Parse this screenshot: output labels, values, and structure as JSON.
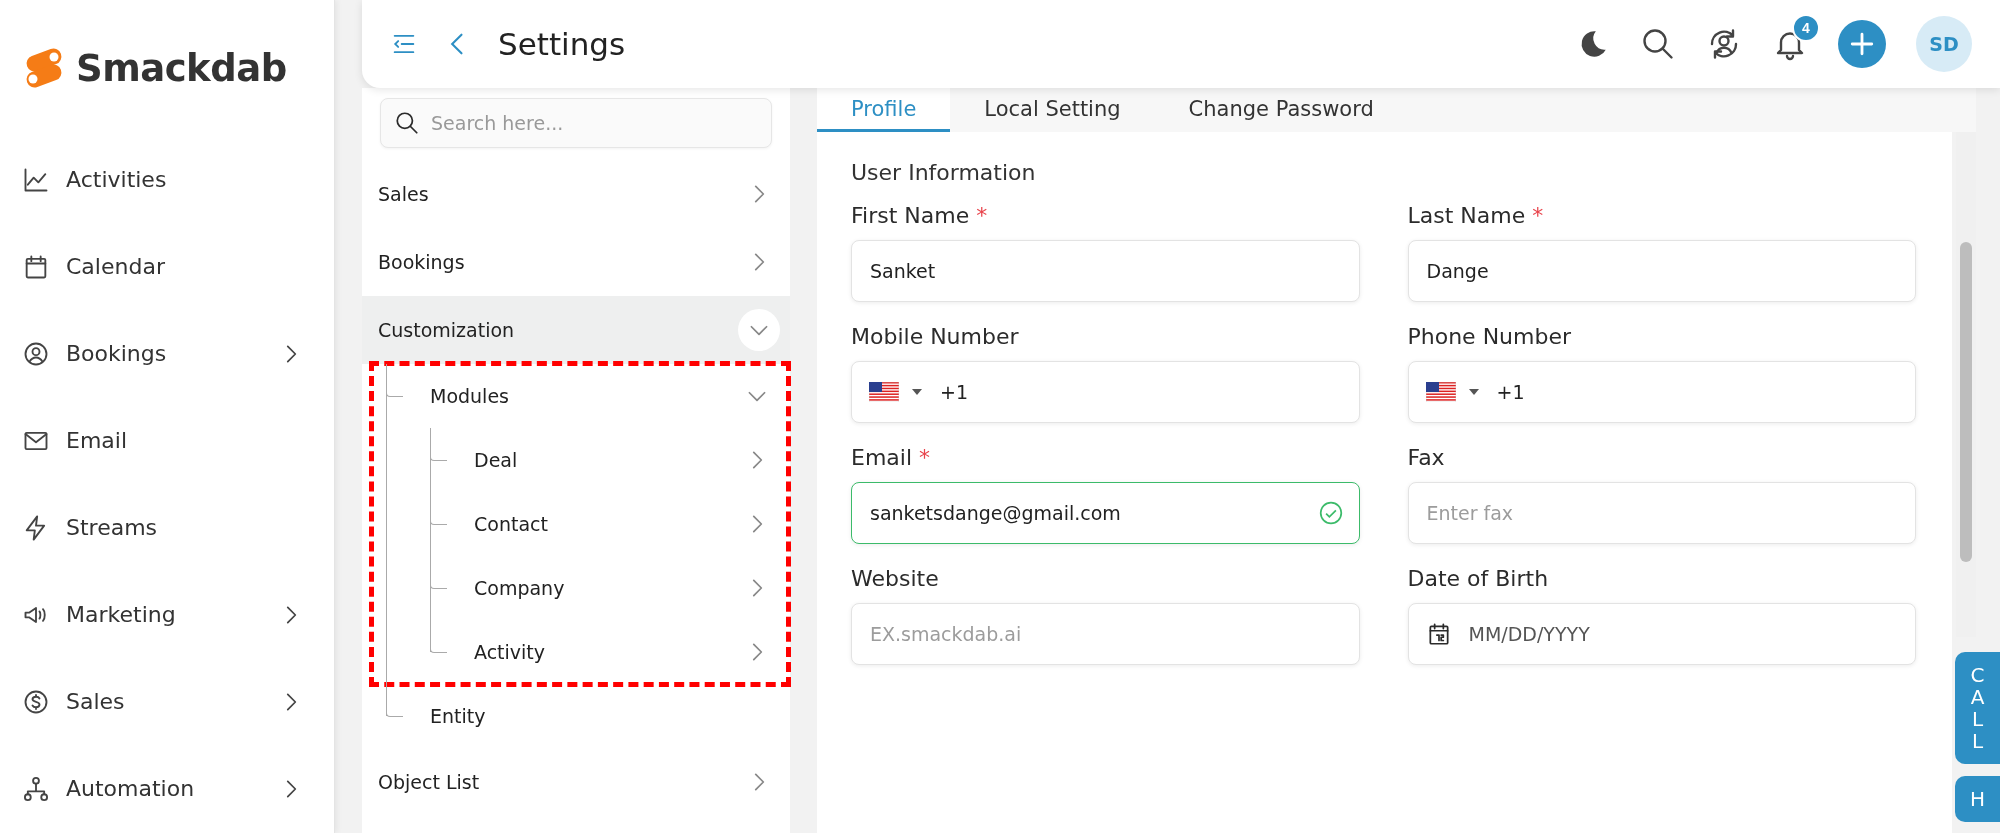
{
  "brand": {
    "name": "Smackdab"
  },
  "nav": [
    {
      "label": "Activities",
      "has_submenu": false
    },
    {
      "label": "Calendar",
      "has_submenu": false
    },
    {
      "label": "Bookings",
      "has_submenu": true
    },
    {
      "label": "Email",
      "has_submenu": false
    },
    {
      "label": "Streams",
      "has_submenu": false
    },
    {
      "label": "Marketing",
      "has_submenu": true
    },
    {
      "label": "Sales",
      "has_submenu": true
    },
    {
      "label": "Automation",
      "has_submenu": true
    }
  ],
  "header": {
    "title": "Settings",
    "notification_count": "4",
    "avatar": "SD"
  },
  "settings_menu": {
    "search_placeholder": "Search here...",
    "items": [
      {
        "label": "Sales",
        "selected": false,
        "expanded": false
      },
      {
        "label": "Bookings",
        "selected": false,
        "expanded": false
      },
      {
        "label": "Customization",
        "selected": true,
        "expanded": true,
        "children": [
          {
            "label": "Modules",
            "expanded": true,
            "highlighted": true,
            "children": [
              {
                "label": "Deal",
                "expanded": false
              },
              {
                "label": "Contact",
                "expanded": false
              },
              {
                "label": "Company",
                "expanded": false
              },
              {
                "label": "Activity",
                "expanded": false
              }
            ]
          },
          {
            "label": "Entity",
            "highlighted": false
          }
        ]
      },
      {
        "label": "Object List",
        "selected": false,
        "expanded": false
      }
    ]
  },
  "tabs": [
    {
      "label": "Profile",
      "selected": true
    },
    {
      "label": "Local Setting",
      "selected": false
    },
    {
      "label": "Change Password",
      "selected": false
    }
  ],
  "form": {
    "section_title": "User Information",
    "fields": [
      {
        "label": "First Name",
        "required_mark": "*",
        "kind": "text",
        "value": "Sanket",
        "valid": false
      },
      {
        "label": "Last Name",
        "required_mark": "*",
        "kind": "text",
        "value": "Dange",
        "valid": false
      },
      {
        "label": "Mobile Number",
        "kind": "phone",
        "value": "+1",
        "valid": false
      },
      {
        "label": "Phone Number",
        "kind": "phone",
        "value": "+1",
        "valid": false
      },
      {
        "label": "Email",
        "required_mark": "*",
        "kind": "text",
        "value": "sanketsdange@gmail.com",
        "valid": true
      },
      {
        "label": "Fax",
        "kind": "text",
        "placeholder": "Enter fax",
        "valid": false
      },
      {
        "label": "Website",
        "kind": "text",
        "placeholder": "EX.smackdab.ai",
        "valid": false
      },
      {
        "label": "Date of Birth",
        "kind": "date",
        "placeholder": "MM/DD/YYYY",
        "valid": false
      }
    ]
  },
  "side_tabs": [
    {
      "label": "CALL"
    },
    {
      "label": "H"
    }
  ]
}
